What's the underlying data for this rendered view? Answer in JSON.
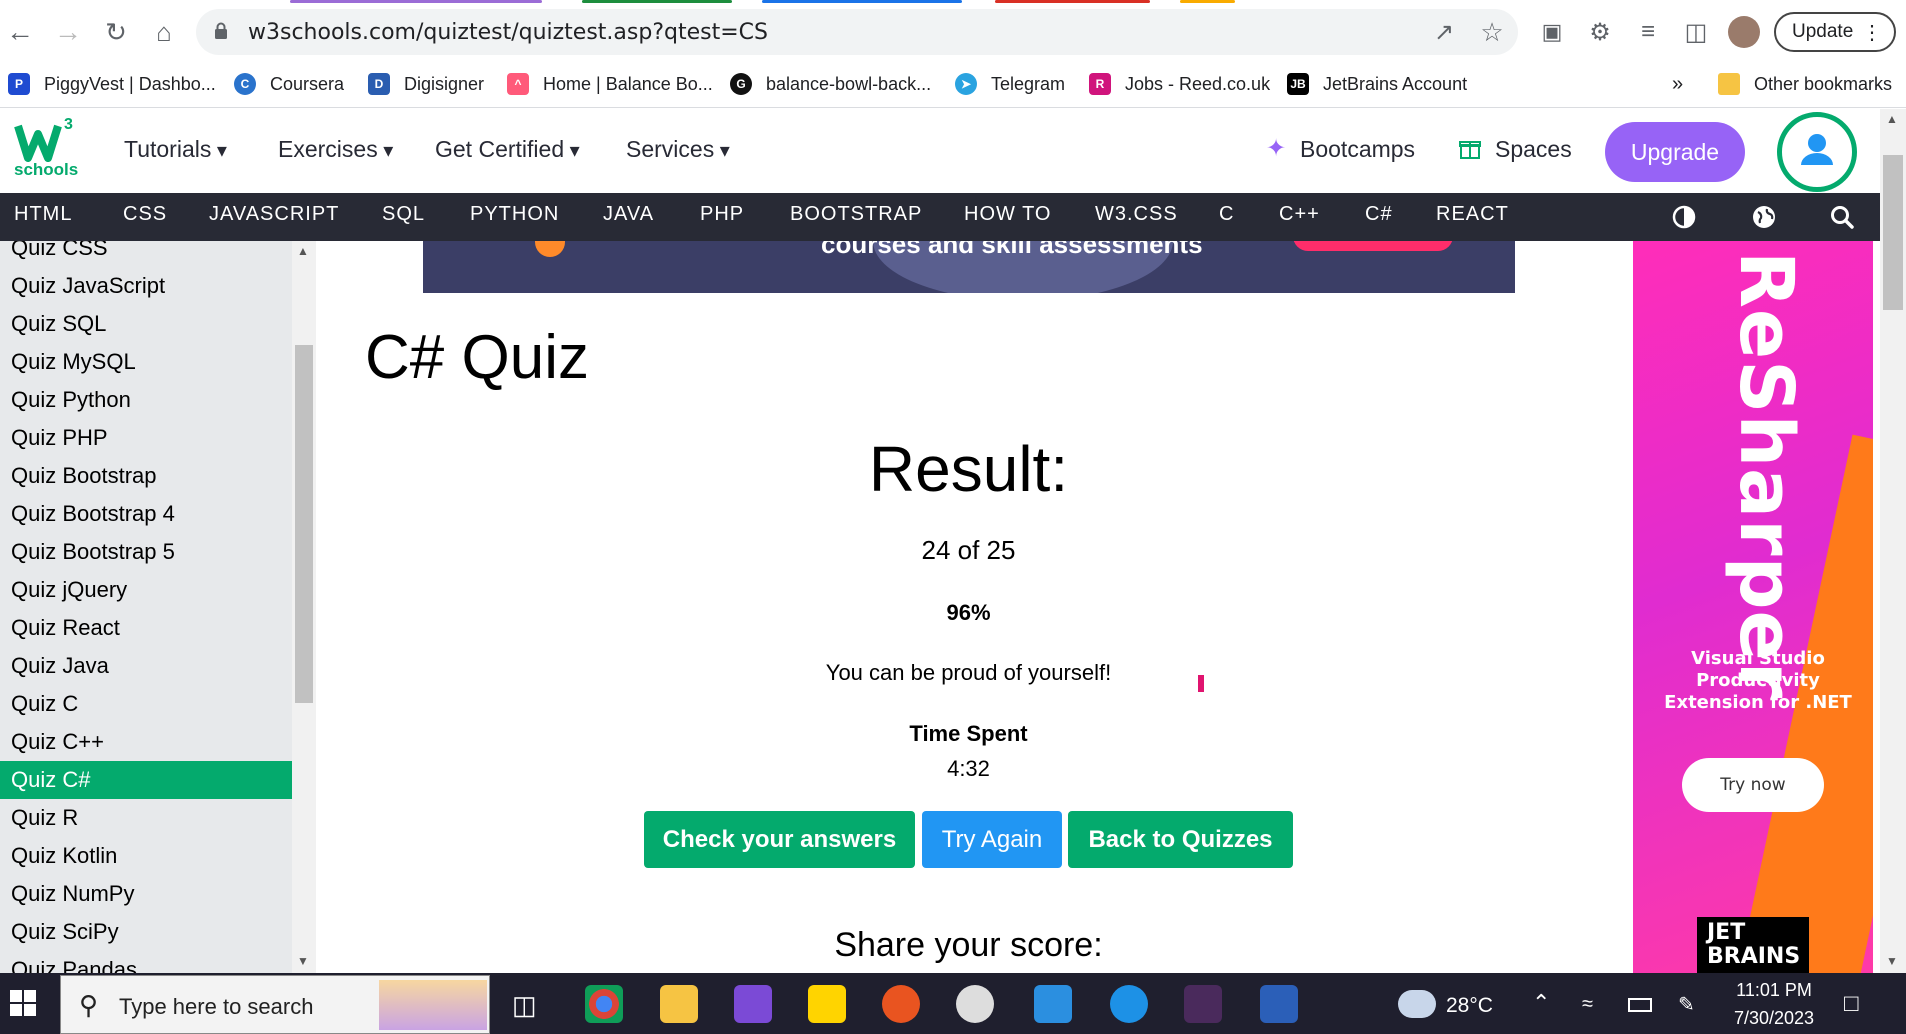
{
  "browser": {
    "url": "w3schools.com/quiztest/quiztest.asp?qtest=CS",
    "update_label": "Update",
    "bookmarks": [
      {
        "label": "PiggyVest | Dashbo...",
        "icon": "piggyvest-icon",
        "color": "#1f4bd1"
      },
      {
        "label": "Coursera",
        "icon": "coursera-icon",
        "color": "#2a73cc"
      },
      {
        "label": "Digisigner",
        "icon": "digisigner-icon",
        "color": "#2a5db0"
      },
      {
        "label": "Home | Balance Bo...",
        "icon": "clickup-icon",
        "color": "#ff5a7a"
      },
      {
        "label": "balance-bowl-back...",
        "icon": "github-icon",
        "color": "#111111"
      },
      {
        "label": "Telegram",
        "icon": "telegram-icon",
        "color": "#2aa3e0"
      },
      {
        "label": "Jobs - Reed.co.uk",
        "icon": "reed-icon",
        "color": "#d0147c"
      },
      {
        "label": "JetBrains Account",
        "icon": "jetbrains-icon",
        "color": "#000000"
      }
    ],
    "more_bookmarks": "»",
    "other_bookmarks": "Other bookmarks"
  },
  "header": {
    "logo_sup": "3",
    "logo_text": "schools",
    "nav": [
      "Tutorials",
      "Exercises",
      "Get Certified",
      "Services"
    ],
    "bootcamps": "Bootcamps",
    "spaces": "Spaces",
    "upgrade": "Upgrade"
  },
  "subnav": [
    "HTML",
    "CSS",
    "JAVASCRIPT",
    "SQL",
    "PYTHON",
    "JAVA",
    "PHP",
    "BOOTSTRAP",
    "HOW TO",
    "W3.CSS",
    "C",
    "C++",
    "C#",
    "REACT"
  ],
  "sidebar": {
    "items": [
      "Quiz CSS",
      "Quiz JavaScript",
      "Quiz SQL",
      "Quiz MySQL",
      "Quiz Python",
      "Quiz PHP",
      "Quiz Bootstrap",
      "Quiz Bootstrap 4",
      "Quiz Bootstrap 5",
      "Quiz jQuery",
      "Quiz React",
      "Quiz Java",
      "Quiz C",
      "Quiz C++",
      "Quiz C#",
      "Quiz R",
      "Quiz Kotlin",
      "Quiz NumPy",
      "Quiz SciPy",
      "Quiz Pandas"
    ],
    "active": "Quiz C#"
  },
  "main": {
    "banner_text": "courses and skill assessments",
    "title": "C# Quiz",
    "result_heading": "Result:",
    "score": "24 of 25",
    "percent": "96%",
    "message": "You can be proud of yourself!",
    "time_label": "Time Spent",
    "time_value": "4:32",
    "buttons": {
      "check": "Check your answers",
      "try_again": "Try Again",
      "back": "Back to Quizzes"
    },
    "share": "Share your score:"
  },
  "ad": {
    "brand": "ReSharper",
    "description": "Visual Studio Productivity Extension for .NET",
    "cta": "Try now",
    "logo_line1": "JET",
    "logo_line2": "BRAINS"
  },
  "taskbar": {
    "search_placeholder": "Type here to search",
    "temperature": "28°C",
    "time": "11:01 PM",
    "date": "7/30/2023"
  },
  "colors": {
    "w3_green": "#04aa6d",
    "upgrade_purple": "#9763f6",
    "try_again_blue": "#2196f3",
    "ad_pink": "#ff2db9"
  }
}
